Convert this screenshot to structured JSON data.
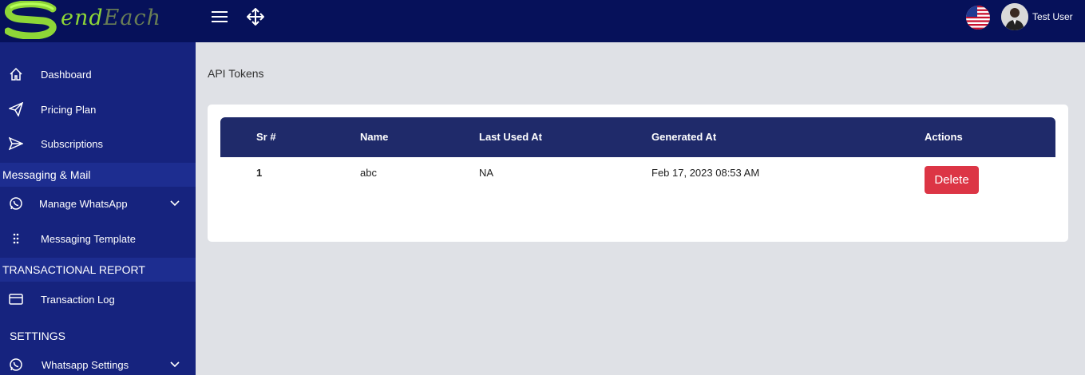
{
  "brand": {
    "logo_text_1": "end",
    "logo_text_2": "Each"
  },
  "user": {
    "name": "Test User"
  },
  "sidebar": {
    "items": [
      {
        "label": "Dashboard",
        "icon": "home-icon"
      },
      {
        "label": "Pricing Plan",
        "icon": "paper-plane-icon"
      },
      {
        "label": "Subscriptions",
        "icon": "send-icon"
      }
    ],
    "sections": [
      {
        "title": "Messaging & Mail"
      },
      {
        "title": "TRANSACTIONAL REPORT"
      },
      {
        "title": "SETTINGS"
      }
    ],
    "messaging_items": [
      {
        "label": "Manage WhatsApp",
        "icon": "whatsapp-icon"
      },
      {
        "label": "Messaging Template",
        "icon": "grip-dots-icon"
      }
    ],
    "report_items": [
      {
        "label": "Transaction Log",
        "icon": "credit-card-icon"
      }
    ],
    "settings_items": [
      {
        "label": "Whatsapp Settings",
        "icon": "whatsapp-icon"
      }
    ]
  },
  "page": {
    "title": "API Tokens"
  },
  "table": {
    "headers": [
      "Sr #",
      "Name",
      "Last Used At",
      "Generated At",
      "Actions"
    ],
    "rows": [
      {
        "sr": "1",
        "name": "abc",
        "last_used": "NA",
        "generated": "Feb 17, 2023 08:53 AM",
        "action": "Delete"
      }
    ]
  },
  "colors": {
    "topbar": "#06115a",
    "sidebar": "#16237e",
    "table_header": "#1f2a6a",
    "danger": "#dc3545"
  }
}
